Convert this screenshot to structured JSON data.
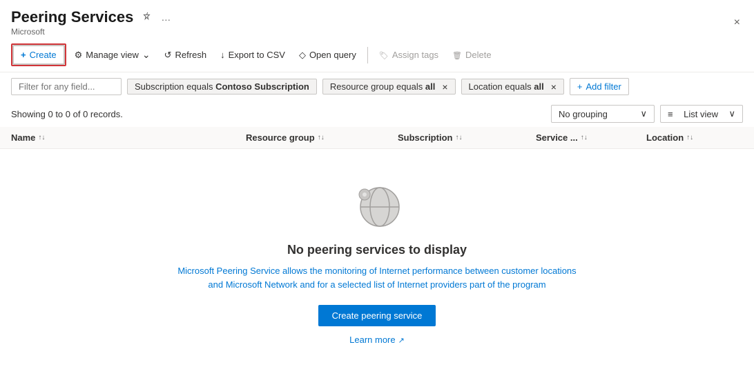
{
  "header": {
    "title": "Peering Services",
    "subtitle": "Microsoft",
    "close_label": "×"
  },
  "toolbar": {
    "create_label": "Create",
    "manage_view_label": "Manage view",
    "refresh_label": "Refresh",
    "export_label": "Export to CSV",
    "open_query_label": "Open query",
    "assign_tags_label": "Assign tags",
    "delete_label": "Delete"
  },
  "filter_bar": {
    "input_placeholder": "Filter for any field...",
    "chips": [
      {
        "label": "Subscription equals ",
        "value": "Contoso Subscription",
        "closeable": false
      },
      {
        "label": "Resource group equals ",
        "value": "all",
        "closeable": true
      },
      {
        "label": "Location equals ",
        "value": "all",
        "closeable": true
      }
    ],
    "add_filter_label": "Add filter"
  },
  "results": {
    "text": "Showing 0 to 0 of 0 records.",
    "grouping_label": "No grouping",
    "view_label": "List view"
  },
  "table": {
    "columns": [
      {
        "label": "Name",
        "sortable": true
      },
      {
        "label": "Resource group",
        "sortable": true
      },
      {
        "label": "Subscription",
        "sortable": true
      },
      {
        "label": "Service ...",
        "sortable": true
      },
      {
        "label": "Location",
        "sortable": true
      }
    ]
  },
  "empty_state": {
    "title": "No peering services to display",
    "description": "Microsoft Peering Service allows the monitoring of Internet performance between customer locations and Microsoft Network and for a selected list of Internet providers part of the program",
    "create_button_label": "Create peering service",
    "learn_more_label": "Learn more"
  }
}
